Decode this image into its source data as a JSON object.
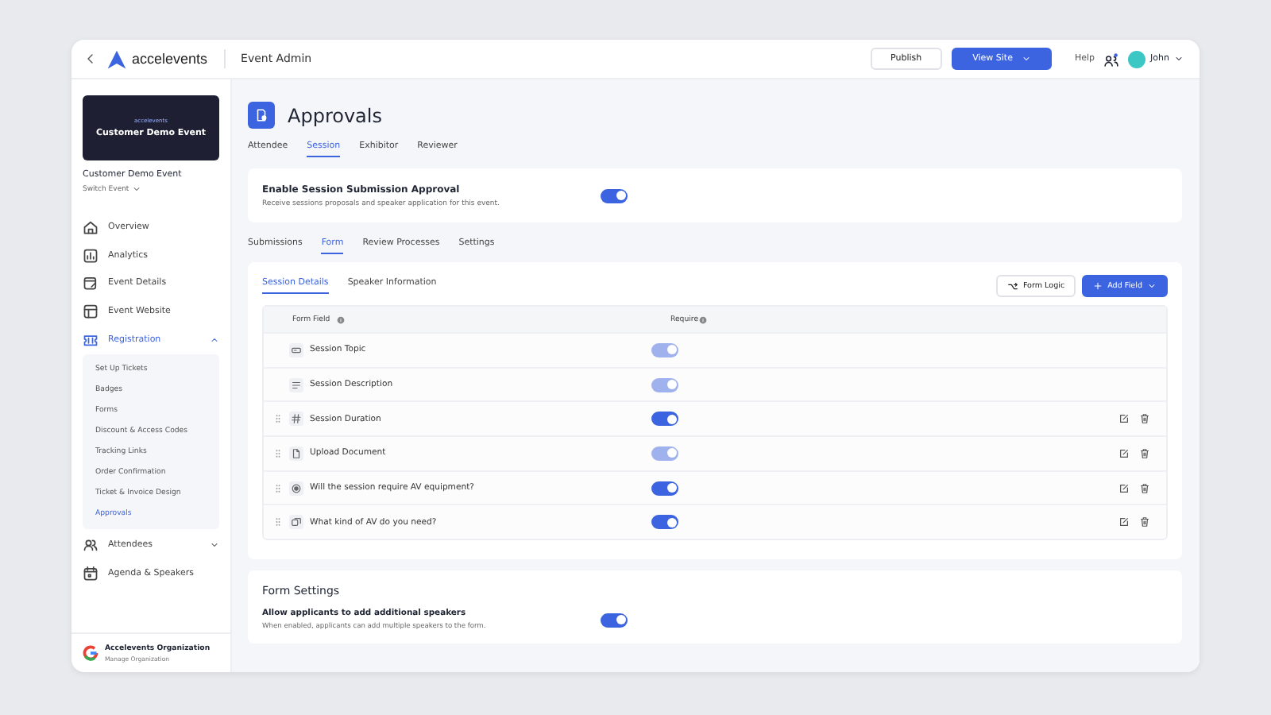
{
  "topbar": {
    "brand": "accelevents",
    "section": "Event Admin",
    "publish": "Publish",
    "view_site": "View Site",
    "help": "Help",
    "user": "John"
  },
  "sidebar": {
    "banner_logo": "accelevents",
    "banner_title": "Customer Demo Event",
    "event_name": "Customer Demo Event",
    "switch_event": "Switch Event",
    "items": [
      {
        "label": "Overview",
        "kind": "link",
        "selected": false
      },
      {
        "label": "Analytics",
        "kind": "link",
        "selected": false
      },
      {
        "label": "Event Details",
        "kind": "link",
        "selected": false
      },
      {
        "label": "Event Website",
        "kind": "link",
        "selected": false
      },
      {
        "label": "Registration",
        "kind": "group",
        "selected": true,
        "expanded": true,
        "children": [
          {
            "label": "Set Up Tickets",
            "selected": false
          },
          {
            "label": "Badges",
            "selected": false
          },
          {
            "label": "Forms",
            "selected": false
          },
          {
            "label": "Discount & Access Codes",
            "selected": false
          },
          {
            "label": "Tracking Links",
            "selected": false
          },
          {
            "label": "Order Confirmation",
            "selected": false
          },
          {
            "label": "Ticket & Invoice Design",
            "selected": false
          },
          {
            "label": "Approvals",
            "selected": true
          }
        ]
      },
      {
        "label": "Attendees",
        "kind": "group",
        "selected": false,
        "expanded": false
      },
      {
        "label": "Agenda & Speakers",
        "kind": "link",
        "selected": false
      }
    ],
    "org_name": "Accelevents Organization",
    "org_link": "Manage Organization"
  },
  "page": {
    "title": "Approvals",
    "tabs": [
      {
        "label": "Attendee",
        "selected": false
      },
      {
        "label": "Session",
        "selected": true
      },
      {
        "label": "Exhibitor",
        "selected": false
      },
      {
        "label": "Reviewer",
        "selected": false
      }
    ],
    "enable": {
      "title": "Enable Session Submission Approval",
      "description": "Receive sessions proposals and speaker application for this event.",
      "on": true
    },
    "subtabs": [
      {
        "label": "Submissions",
        "selected": false
      },
      {
        "label": "Form",
        "selected": true
      },
      {
        "label": "Review Processes",
        "selected": false
      },
      {
        "label": "Settings",
        "selected": false
      }
    ],
    "form_tabs": [
      {
        "label": "Session Details",
        "selected": true
      },
      {
        "label": "Speaker Information",
        "selected": false
      }
    ],
    "form_logic": "Form Logic",
    "add_field": "Add Field",
    "table": {
      "columns": [
        "Form Field",
        "Require"
      ],
      "rows": [
        {
          "label": "Session Topic",
          "kind": "fixed",
          "required": true,
          "disabled": true
        },
        {
          "label": "Session Description",
          "kind": "fixed",
          "required": true,
          "disabled": true
        },
        {
          "label": "Session Duration",
          "kind": "custom",
          "required": true,
          "disabled": false
        },
        {
          "label": "Upload Document",
          "kind": "custom",
          "required": true,
          "disabled": true
        },
        {
          "label": "Will the session require AV equipment?",
          "kind": "custom",
          "required": true,
          "disabled": false
        },
        {
          "label": "What kind of AV do you need?",
          "kind": "custom",
          "required": true,
          "disabled": false
        }
      ]
    },
    "form_settings": {
      "title": "Form Settings",
      "option": "Allow applicants to add additional speakers",
      "description": "When enabled, applicants can add multiple speakers to the form.",
      "on": true
    }
  }
}
